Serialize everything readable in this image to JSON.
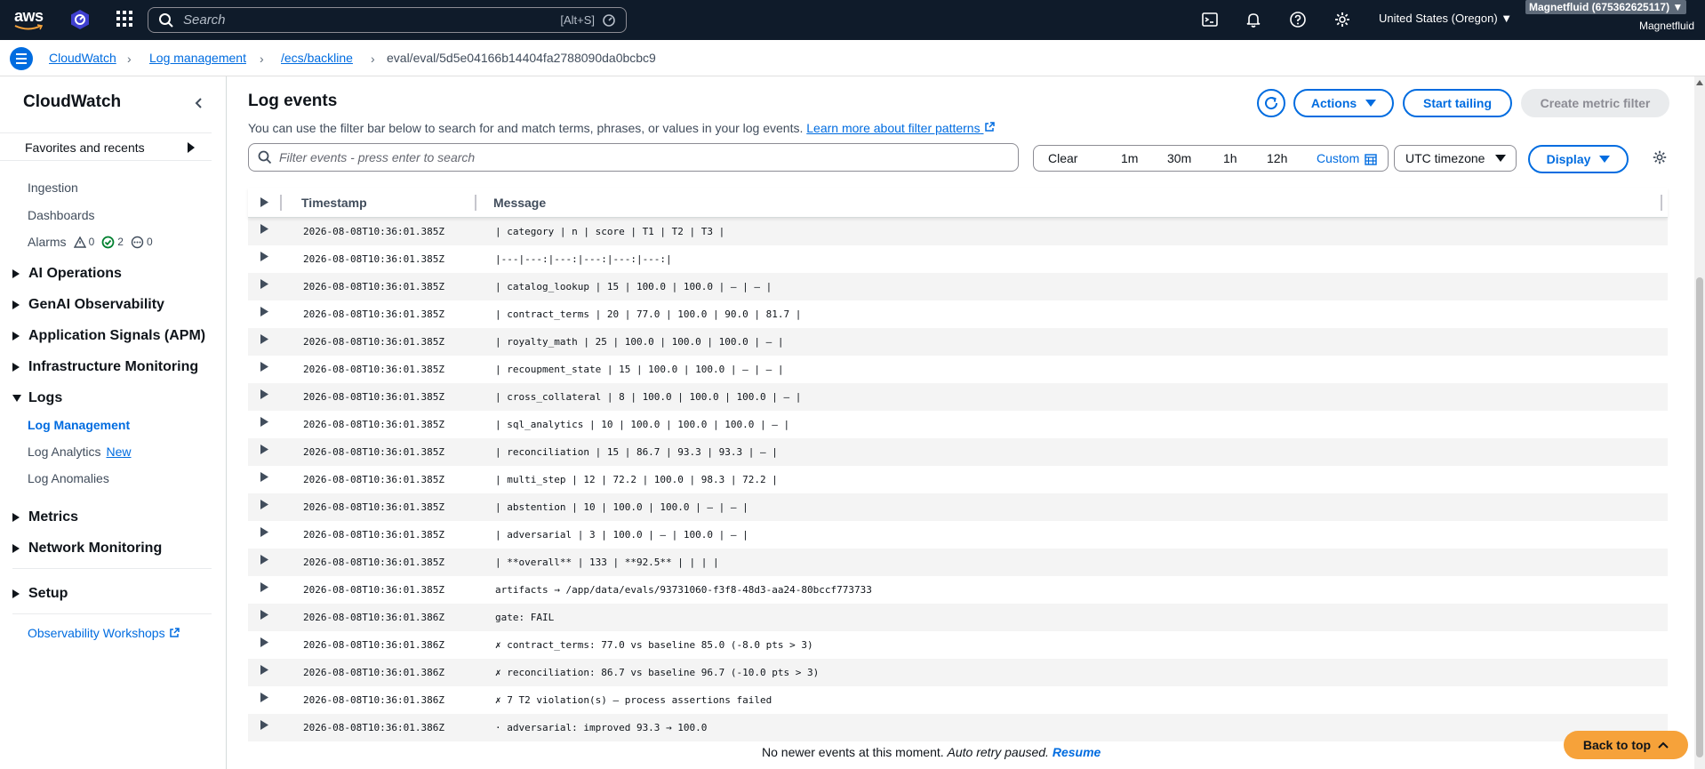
{
  "topnav": {
    "logo_text": "aws",
    "search_placeholder": "Search",
    "search_shortcut": "[Alt+S]",
    "region": "United States (Oregon) ▼",
    "account": "Magnetfluid (675362625117) ▼",
    "account_name": "Magnetfluid"
  },
  "breadcrumb": {
    "items": [
      "CloudWatch",
      "Log management",
      "/ecs/backline"
    ],
    "current": "eval/eval/5d5e04166b14404fa2788090da0bcbc9"
  },
  "sidebar": {
    "title": "CloudWatch",
    "favorites": "Favorites and recents",
    "ingestion": "Ingestion",
    "dashboards": "Dashboards",
    "alarms": "Alarms",
    "alarm_counts": {
      "alarm": "0",
      "ok": "2",
      "insufficient": "0"
    },
    "groups": {
      "ai_ops": "AI Operations",
      "genai": "GenAI Observability",
      "app_signals": "Application Signals (APM)",
      "infra": "Infrastructure Monitoring",
      "logs": "Logs",
      "metrics": "Metrics",
      "network": "Network Monitoring",
      "setup": "Setup"
    },
    "logs_items": {
      "management": "Log Management",
      "analytics": "Log Analytics",
      "analytics_badge": "New",
      "anomalies": "Log Anomalies"
    },
    "workshops": "Observability Workshops"
  },
  "panel": {
    "title": "Log events",
    "description": "You can use the filter bar below to search for and match terms, phrases, or values in your log events.",
    "learn_more": "Learn more about filter patterns",
    "actions": "Actions",
    "start_tailing": "Start tailing",
    "create_metric": "Create metric filter",
    "filter_placeholder": "Filter events - press enter to search",
    "time": {
      "clear": "Clear",
      "m1": "1m",
      "m30": "30m",
      "h1": "1h",
      "h12": "12h",
      "custom": "Custom"
    },
    "timezone": "UTC timezone",
    "display": "Display"
  },
  "table": {
    "col_timestamp": "Timestamp",
    "col_message": "Message",
    "rows": [
      {
        "ts": "2026-08-08T10:36:01.385Z",
        "msg": "| category | n | score | T1 | T2 | T3 |"
      },
      {
        "ts": "2026-08-08T10:36:01.385Z",
        "msg": "|---|---:|---:|---:|---:|---:|"
      },
      {
        "ts": "2026-08-08T10:36:01.385Z",
        "msg": "| catalog_lookup | 15 | 100.0 | 100.0 | — | — |"
      },
      {
        "ts": "2026-08-08T10:36:01.385Z",
        "msg": "| contract_terms | 20 | 77.0 | 100.0 | 90.0 | 81.7 |"
      },
      {
        "ts": "2026-08-08T10:36:01.385Z",
        "msg": "| royalty_math | 25 | 100.0 | 100.0 | 100.0 | — |"
      },
      {
        "ts": "2026-08-08T10:36:01.385Z",
        "msg": "| recoupment_state | 15 | 100.0 | 100.0 | — | — |"
      },
      {
        "ts": "2026-08-08T10:36:01.385Z",
        "msg": "| cross_collateral | 8 | 100.0 | 100.0 | 100.0 | — |"
      },
      {
        "ts": "2026-08-08T10:36:01.385Z",
        "msg": "| sql_analytics | 10 | 100.0 | 100.0 | 100.0 | — |"
      },
      {
        "ts": "2026-08-08T10:36:01.385Z",
        "msg": "| reconciliation | 15 | 86.7 | 93.3 | 93.3 | — |"
      },
      {
        "ts": "2026-08-08T10:36:01.385Z",
        "msg": "| multi_step | 12 | 72.2 | 100.0 | 98.3 | 72.2 |"
      },
      {
        "ts": "2026-08-08T10:36:01.385Z",
        "msg": "| abstention | 10 | 100.0 | 100.0 | — | — |"
      },
      {
        "ts": "2026-08-08T10:36:01.385Z",
        "msg": "| adversarial | 3 | 100.0 | — | 100.0 | — |"
      },
      {
        "ts": "2026-08-08T10:36:01.385Z",
        "msg": "| **overall** | 133 | **92.5** | | | |"
      },
      {
        "ts": "2026-08-08T10:36:01.385Z",
        "msg": "artifacts → /app/data/evals/93731060-f3f8-48d3-aa24-80bccf773733"
      },
      {
        "ts": "2026-08-08T10:36:01.386Z",
        "msg": "gate: FAIL"
      },
      {
        "ts": "2026-08-08T10:36:01.386Z",
        "msg": "✗ contract_terms: 77.0 vs baseline 85.0 (-8.0 pts > 3)"
      },
      {
        "ts": "2026-08-08T10:36:01.386Z",
        "msg": "✗ reconciliation: 86.7 vs baseline 96.7 (-10.0 pts > 3)"
      },
      {
        "ts": "2026-08-08T10:36:01.386Z",
        "msg": "✗ 7 T2 violation(s) — process assertions failed"
      },
      {
        "ts": "2026-08-08T10:36:01.386Z",
        "msg": "· adversarial: improved 93.3 → 100.0"
      }
    ]
  },
  "footer": {
    "no_newer": "No newer events at this moment.",
    "auto_retry": "Auto retry paused.",
    "resume": "Resume",
    "back_to_top": "Back to top"
  }
}
